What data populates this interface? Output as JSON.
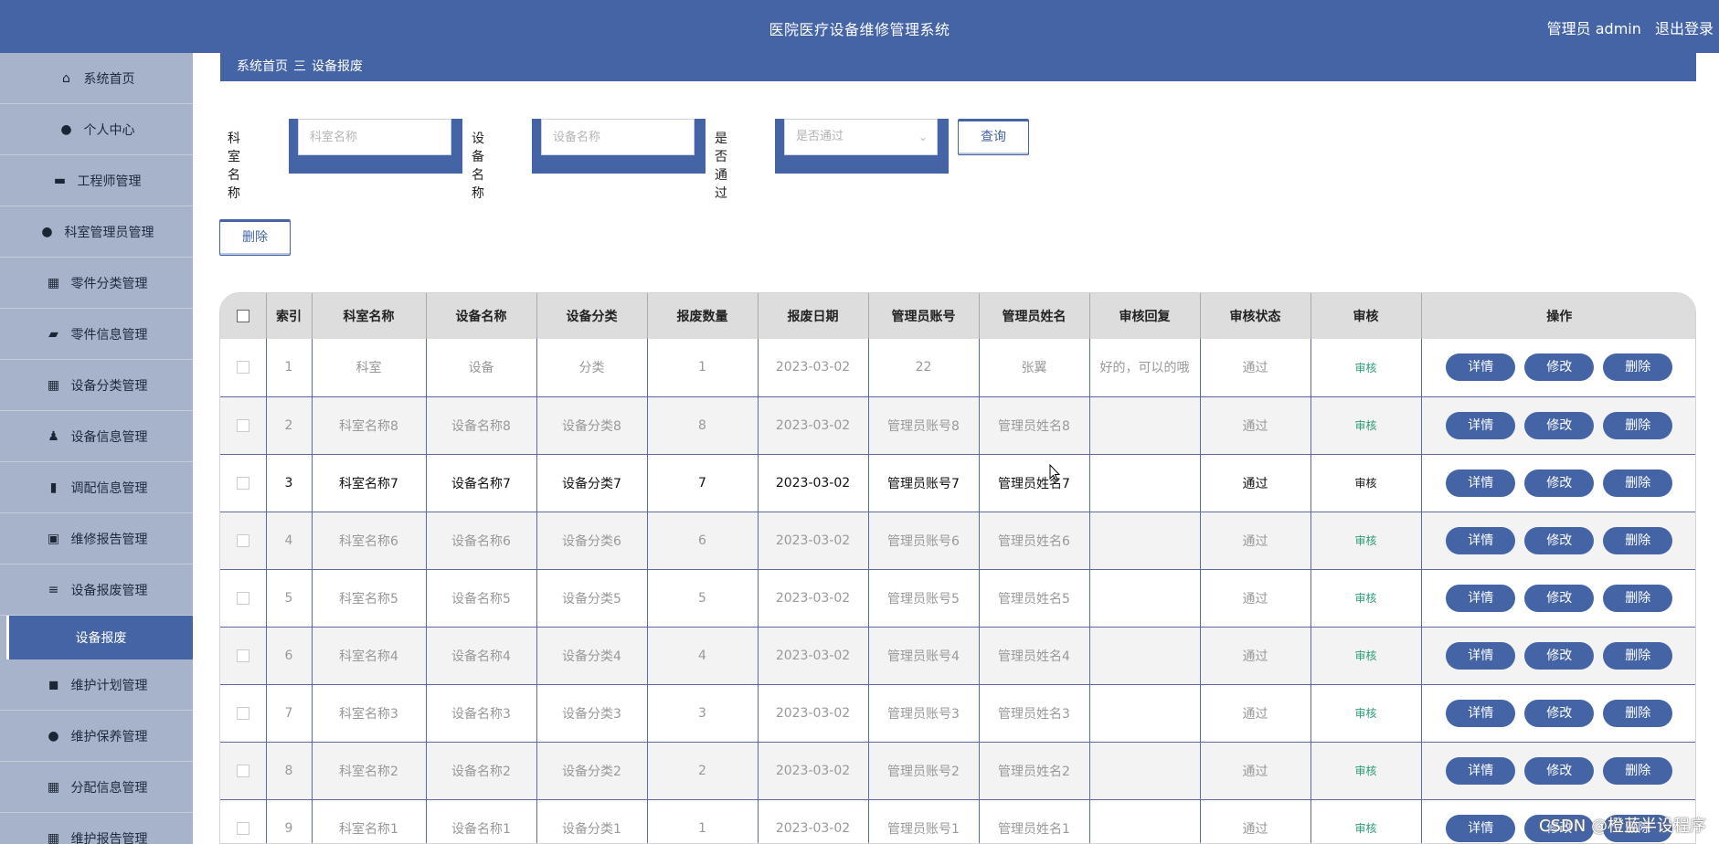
{
  "app": {
    "title": "医院医疗设备维修管理系统",
    "user_label": "管理员 admin",
    "logout": "退出登录"
  },
  "sidebar": {
    "items": [
      {
        "label": "系统首页",
        "icon": "home-icon"
      },
      {
        "label": "个人中心",
        "icon": "user-icon"
      },
      {
        "label": "工程师管理",
        "icon": "monitor-icon"
      },
      {
        "label": "科室管理员管理",
        "icon": "bulb-icon"
      },
      {
        "label": "零件分类管理",
        "icon": "grid-icon"
      },
      {
        "label": "零件信息管理",
        "icon": "cup-icon"
      },
      {
        "label": "设备分类管理",
        "icon": "grid-icon"
      },
      {
        "label": "设备信息管理",
        "icon": "person-icon"
      },
      {
        "label": "调配信息管理",
        "icon": "clipboard-icon"
      },
      {
        "label": "维修报告管理",
        "icon": "doc-x-icon"
      },
      {
        "label": "设备报废管理",
        "icon": "list-icon"
      }
    ],
    "active_sub": "设备报废",
    "items_after": [
      {
        "label": "维护计划管理",
        "icon": "camera-icon"
      },
      {
        "label": "维护保养管理",
        "icon": "user-icon"
      },
      {
        "label": "分配信息管理",
        "icon": "grid-icon"
      },
      {
        "label": "维护报告管理",
        "icon": "grid-icon"
      }
    ]
  },
  "breadcrumb": {
    "home": "系统首页",
    "sep": "三",
    "current": "设备报废"
  },
  "search": {
    "dept_label": "科室名称",
    "dept_placeholder": "科室名称",
    "device_label": "设备名称",
    "device_placeholder": "设备名称",
    "pass_label": "是否通过",
    "pass_placeholder": "是否通过",
    "query_button": "查询"
  },
  "delete_button": "删除",
  "table": {
    "headers": [
      "索引",
      "科室名称",
      "设备名称",
      "设备分类",
      "报废数量",
      "报废日期",
      "管理员账号",
      "管理员姓名",
      "审核回复",
      "审核状态",
      "审核",
      "操作"
    ],
    "actions": {
      "detail": "详情",
      "edit": "修改",
      "delete": "删除"
    },
    "rows": [
      {
        "idx": "1",
        "dept": "科室",
        "device": "设备",
        "cat": "分类",
        "qty": "1",
        "date": "2023-03-02",
        "acct": "22",
        "name": "张翼",
        "reply": "好的，可以的哦",
        "status": "通过",
        "audit": "审核"
      },
      {
        "idx": "2",
        "dept": "科室名称8",
        "device": "设备名称8",
        "cat": "设备分类8",
        "qty": "8",
        "date": "2023-03-02",
        "acct": "管理员账号8",
        "name": "管理员姓名8",
        "reply": "",
        "status": "通过",
        "audit": "审核"
      },
      {
        "idx": "3",
        "dept": "科室名称7",
        "device": "设备名称7",
        "cat": "设备分类7",
        "qty": "7",
        "date": "2023-03-02",
        "acct": "管理员账号7",
        "name": "管理员姓名7",
        "reply": "",
        "status": "通过",
        "audit": "审核"
      },
      {
        "idx": "4",
        "dept": "科室名称6",
        "device": "设备名称6",
        "cat": "设备分类6",
        "qty": "6",
        "date": "2023-03-02",
        "acct": "管理员账号6",
        "name": "管理员姓名6",
        "reply": "",
        "status": "通过",
        "audit": "审核"
      },
      {
        "idx": "5",
        "dept": "科室名称5",
        "device": "设备名称5",
        "cat": "设备分类5",
        "qty": "5",
        "date": "2023-03-02",
        "acct": "管理员账号5",
        "name": "管理员姓名5",
        "reply": "",
        "status": "通过",
        "audit": "审核"
      },
      {
        "idx": "6",
        "dept": "科室名称4",
        "device": "设备名称4",
        "cat": "设备分类4",
        "qty": "4",
        "date": "2023-03-02",
        "acct": "管理员账号4",
        "name": "管理员姓名4",
        "reply": "",
        "status": "通过",
        "audit": "审核"
      },
      {
        "idx": "7",
        "dept": "科室名称3",
        "device": "设备名称3",
        "cat": "设备分类3",
        "qty": "3",
        "date": "2023-03-02",
        "acct": "管理员账号3",
        "name": "管理员姓名3",
        "reply": "",
        "status": "通过",
        "audit": "审核"
      },
      {
        "idx": "8",
        "dept": "科室名称2",
        "device": "设备名称2",
        "cat": "设备分类2",
        "qty": "2",
        "date": "2023-03-02",
        "acct": "管理员账号2",
        "name": "管理员姓名2",
        "reply": "",
        "status": "通过",
        "audit": "审核"
      },
      {
        "idx": "9",
        "dept": "科室名称1",
        "device": "设备名称1",
        "cat": "设备分类1",
        "qty": "1",
        "date": "2023-03-02",
        "acct": "管理员账号1",
        "name": "管理员姓名1",
        "reply": "",
        "status": "通过",
        "audit": "审核"
      }
    ]
  },
  "watermark": "CSDN @橙蓝半设程序",
  "colors": {
    "primary": "#4564a5",
    "sidebar": "#a6b3cb",
    "audit": "#2a9d76"
  }
}
